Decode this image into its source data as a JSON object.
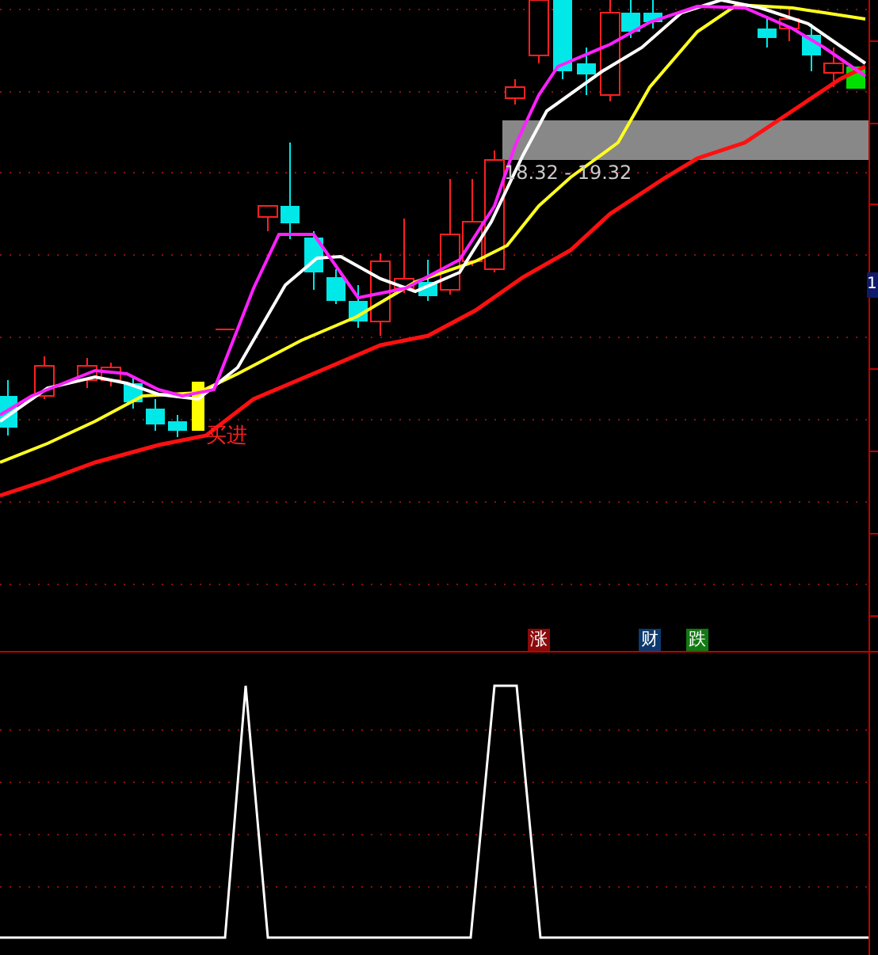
{
  "main_chart": {
    "range_label": "18.32 - 19.32",
    "signal_label": "买进",
    "axis_tag": "1",
    "markers": [
      {
        "text": "涨",
        "color": "#8b0a0a"
      },
      {
        "text": "财",
        "color": "#0c3a6e"
      },
      {
        "text": "跌",
        "color": "#127a12"
      }
    ]
  }
}
